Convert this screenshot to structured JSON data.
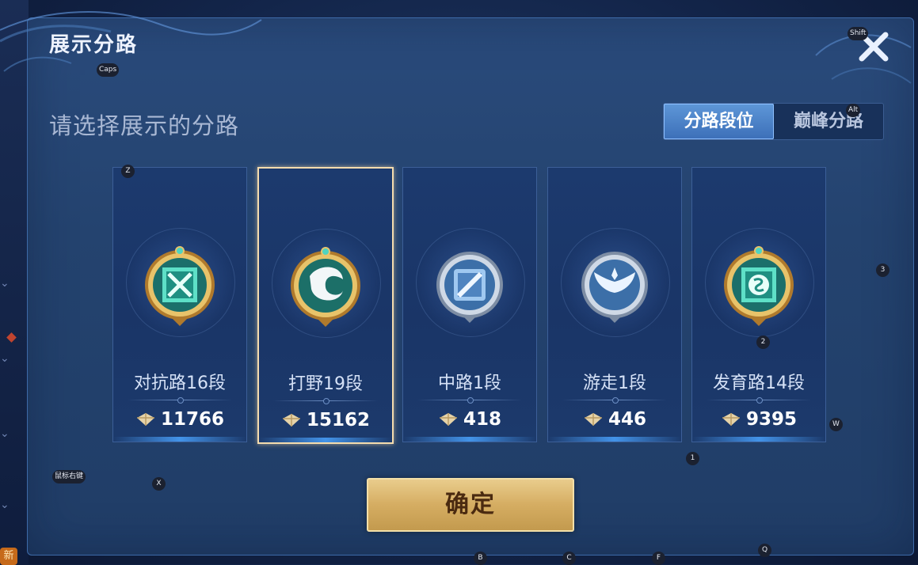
{
  "dialog": {
    "title": "展示分路",
    "subtitle": "请选择展示的分路",
    "tabs": [
      {
        "label": "分路段位",
        "active": true
      },
      {
        "label": "巅峰分路",
        "active": false
      }
    ],
    "confirm_label": "确定",
    "close_icon": "close-icon"
  },
  "cards": [
    {
      "label": "对抗路16段",
      "score": "11766",
      "emblem": "crossed-swords-emblem",
      "tier": "gold",
      "selected": false
    },
    {
      "label": "打野19段",
      "score": "15162",
      "emblem": "dragon-emblem",
      "tier": "gold",
      "selected": true
    },
    {
      "label": "中路1段",
      "score": "418",
      "emblem": "mid-lane-emblem",
      "tier": "silver",
      "selected": false
    },
    {
      "label": "游走1段",
      "score": "446",
      "emblem": "wings-emblem",
      "tier": "silver",
      "selected": false
    },
    {
      "label": "发育路14段",
      "score": "9395",
      "emblem": "marksman-emblem",
      "tier": "gold",
      "selected": false
    }
  ],
  "key_hints": [
    "Shift",
    "Caps",
    "Alt",
    "Z",
    "3",
    "2",
    "W",
    "1",
    "鼠标右键",
    "X",
    "B",
    "C",
    "F",
    "Q"
  ],
  "colors": {
    "accent_blue": "#5e97d8",
    "gold": "#d5ad62",
    "selected_border": "#f4dcae"
  }
}
